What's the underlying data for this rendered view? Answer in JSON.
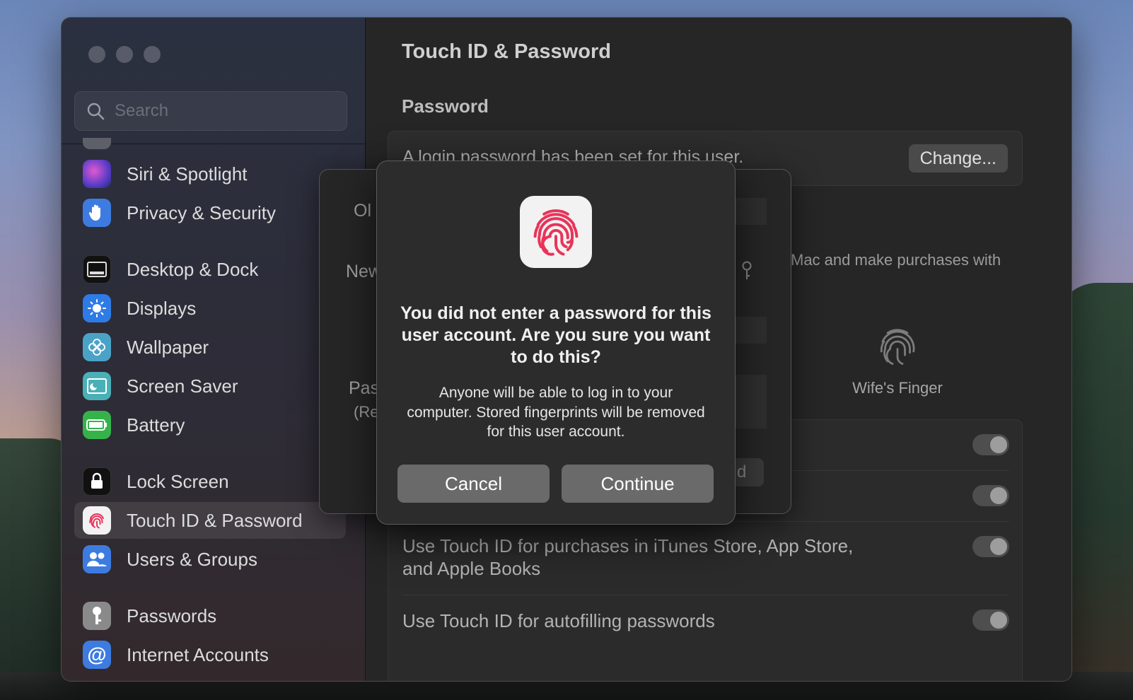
{
  "window": {
    "title": "Touch ID & Password"
  },
  "sidebar": {
    "search_placeholder": "Search",
    "items": [
      {
        "label": "Siri & Spotlight",
        "icon": "siri-icon",
        "color": "#7a3fbf"
      },
      {
        "label": "Privacy & Security",
        "icon": "hand-icon",
        "color": "#3d7be0"
      },
      {
        "label": "Desktop & Dock",
        "icon": "dock-icon",
        "color": "#111111"
      },
      {
        "label": "Displays",
        "icon": "sun-icon",
        "color": "#2f7be6"
      },
      {
        "label": "Wallpaper",
        "icon": "flower-icon",
        "color": "#4aa3c7"
      },
      {
        "label": "Screen Saver",
        "icon": "screensaver-icon",
        "color": "#4ab0b8"
      },
      {
        "label": "Battery",
        "icon": "battery-icon",
        "color": "#35b34a"
      },
      {
        "label": "Lock Screen",
        "icon": "lock-icon",
        "color": "#111111"
      },
      {
        "label": "Touch ID & Password",
        "icon": "fingerprint-icon",
        "color": "#ffffff",
        "selected": true
      },
      {
        "label": "Users & Groups",
        "icon": "users-icon",
        "color": "#3d7be0"
      },
      {
        "label": "Passwords",
        "icon": "key-icon",
        "color": "#8a8a8a"
      },
      {
        "label": "Internet Accounts",
        "icon": "at-icon",
        "color": "#3d7be0"
      }
    ]
  },
  "main": {
    "title": "Touch ID & Password",
    "password_section": {
      "title": "Password",
      "status": "A login password has been set for this user.",
      "change_button": "Change..."
    },
    "touch_id_desc": "Mac and make purchases with",
    "fingerprint_label": "Wife's Finger",
    "toggles": [
      {
        "label": "",
        "on": true
      },
      {
        "label": "",
        "on": true
      },
      {
        "label": "Use Touch ID for purchases in iTunes Store, App Store, and Apple Books",
        "on": true
      },
      {
        "label": "Use Touch ID for autofilling passwords",
        "on": true
      }
    ]
  },
  "change_sheet": {
    "old_label": "Ol",
    "new_label": "New",
    "pass_label": "Pas",
    "pass_sub": "(Re",
    "button_fragment": "d"
  },
  "alert": {
    "icon": "fingerprint-icon",
    "title": "You did not enter a password for this user account. Are you sure you want to do this?",
    "message": "Anyone will be able to log in to your computer. Stored fingerprints will be removed for this user account.",
    "cancel_label": "Cancel",
    "continue_label": "Continue",
    "accent": "#e8345a"
  }
}
